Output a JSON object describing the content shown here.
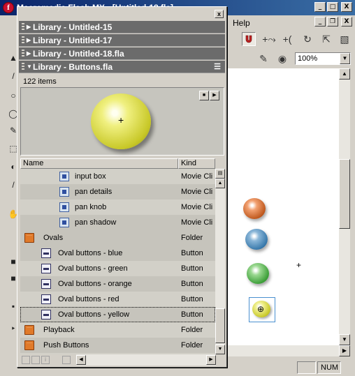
{
  "app": {
    "title": "Macromedia Flash MX - [Untitled-18.fla]",
    "logo": "f",
    "menu_help": "Help",
    "window_buttons": [
      "_",
      "□",
      "X"
    ],
    "doc_buttons": [
      "_",
      "❐",
      "X"
    ]
  },
  "toolbar": {
    "zoom_value": "100%",
    "icons": [
      "magnet-icon",
      "smooth-icon",
      "straighten-icon",
      "rotate-icon",
      "scale-icon",
      "align-icon",
      "stroke-color-icon",
      "fill-color-icon"
    ]
  },
  "library": {
    "close_label": "x",
    "headers": [
      {
        "label": "Library - Untitled-15",
        "expanded": false
      },
      {
        "label": "Library - Untitled-17",
        "expanded": false
      },
      {
        "label": "Library - Untitled-18.fla",
        "expanded": false
      },
      {
        "label": "Library - Buttons.fla",
        "expanded": true
      }
    ],
    "items_count": "122 items",
    "preview_buttons": [
      "■",
      "▶"
    ],
    "columns": {
      "name": "Name",
      "kind": "Kind"
    },
    "rows": [
      {
        "icon": "movie-clip-icon",
        "name": "input box",
        "kind": "Movie Cli"
      },
      {
        "icon": "movie-clip-icon",
        "name": "pan details",
        "kind": "Movie Cli"
      },
      {
        "icon": "movie-clip-icon",
        "name": "pan knob",
        "kind": "Movie Cli"
      },
      {
        "icon": "movie-clip-icon",
        "name": "pan shadow",
        "kind": "Movie Cli"
      },
      {
        "icon": "folder-icon",
        "name": "Ovals",
        "kind": "Folder"
      },
      {
        "icon": "button-icon",
        "name": "Oval buttons - blue",
        "kind": "Button"
      },
      {
        "icon": "button-icon",
        "name": "Oval buttons - green",
        "kind": "Button"
      },
      {
        "icon": "button-icon",
        "name": "Oval buttons - orange",
        "kind": "Button"
      },
      {
        "icon": "button-icon",
        "name": "Oval buttons - red",
        "kind": "Button"
      },
      {
        "icon": "button-icon",
        "name": "Oval buttons - yellow",
        "kind": "Button"
      },
      {
        "icon": "folder-icon",
        "name": "Playback",
        "kind": "Folder"
      },
      {
        "icon": "folder-icon",
        "name": "Push Buttons",
        "kind": "Folder"
      }
    ]
  },
  "status": {
    "num": "NUM"
  },
  "colors": {
    "title_bar": "#0a246a",
    "panel_header": "#6b6b6b",
    "selection": "#4a90d0"
  }
}
